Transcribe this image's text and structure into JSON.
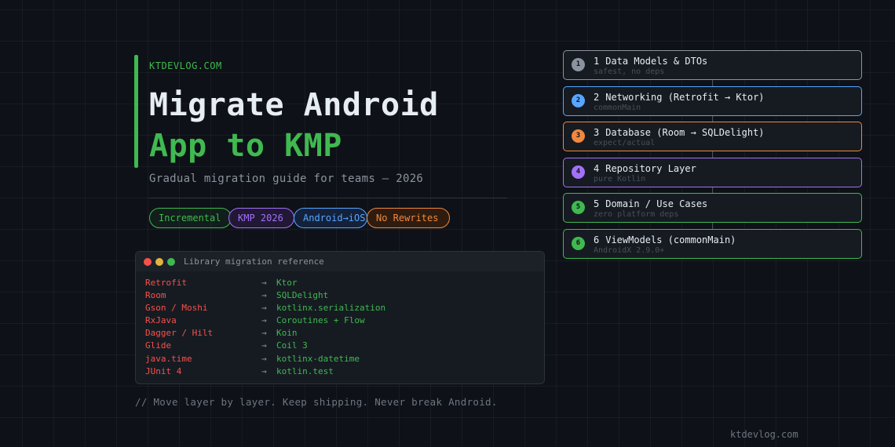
{
  "header": {
    "site_tag": "KTDEVLOG.COM",
    "title_line1": "Migrate Android",
    "title_line2": "App to KMP",
    "subtitle": "Gradual migration guide for teams — 2026"
  },
  "pills": [
    "Incremental",
    "KMP 2026",
    "Android→iOS",
    "No Rewrites"
  ],
  "terminal": {
    "title": "Library migration reference",
    "rows": [
      {
        "from": "Retrofit",
        "arrow": "→",
        "to": "Ktor"
      },
      {
        "from": "Room",
        "arrow": "→",
        "to": "SQLDelight"
      },
      {
        "from": "Gson / Moshi",
        "arrow": "→",
        "to": "kotlinx.serialization"
      },
      {
        "from": "RxJava",
        "arrow": "→",
        "to": "Coroutines + Flow"
      },
      {
        "from": "Dagger / Hilt",
        "arrow": "→",
        "to": "Koin"
      },
      {
        "from": "Glide",
        "arrow": "→",
        "to": "Coil 3"
      },
      {
        "from": "java.time",
        "arrow": "→",
        "to": "kotlinx-datetime"
      },
      {
        "from": "JUnit 4",
        "arrow": "→",
        "to": "kotlin.test"
      }
    ]
  },
  "tagline": "// Move layer by layer. Keep shipping. Never break Android.",
  "footer_site": "ktdevlog.com",
  "steps": [
    {
      "num": "1",
      "label": "Data Models & DTOs",
      "sub": "safest, no deps",
      "color": "#8b949e"
    },
    {
      "num": "2",
      "label": "Networking (Retrofit → Ktor)",
      "sub": "commonMain",
      "color": "#58a6ff"
    },
    {
      "num": "3",
      "label": "Database (Room → SQLDelight)",
      "sub": "expect/actual",
      "color": "#f0883e"
    },
    {
      "num": "4",
      "label": "Repository Layer",
      "sub": "pure Kotlin",
      "color": "#a371f7"
    },
    {
      "num": "5",
      "label": "Domain / Use Cases",
      "sub": "zero platform deps",
      "color": "#3fb950"
    },
    {
      "num": "6",
      "label": "ViewModels (commonMain)",
      "sub": "AndroidX 2.9.0+",
      "color": "#3fb950"
    }
  ]
}
